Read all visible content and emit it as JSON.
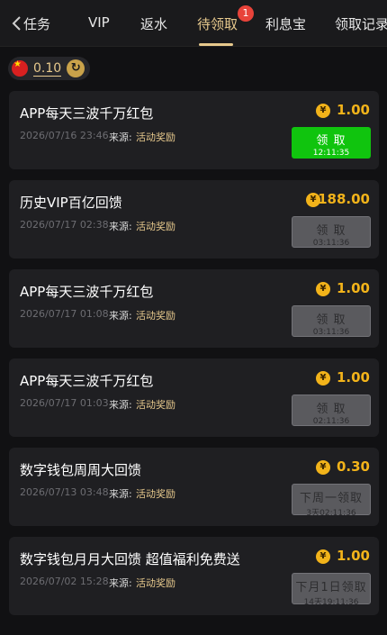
{
  "tabs": [
    {
      "label": "任务"
    },
    {
      "label": "VIP"
    },
    {
      "label": "返水"
    },
    {
      "label": "待领取",
      "badge": "1",
      "active": true
    },
    {
      "label": "利息宝"
    },
    {
      "label": "领取记录"
    }
  ],
  "balance": {
    "value": "0.10"
  },
  "source_label": "来源:",
  "cards": [
    {
      "title": "APP每天三波千万红包",
      "date": "2026/07/16 23:46",
      "source": "活动奖励",
      "amount": "1.00",
      "button": "领 取",
      "timer": "12:11:35",
      "state": "active"
    },
    {
      "title": "历史VIP百亿回馈",
      "date": "2026/07/17 02:38",
      "source": "活动奖励",
      "amount": "188.00",
      "button": "领 取",
      "timer": "03:11:36",
      "state": "disabled"
    },
    {
      "title": "APP每天三波千万红包",
      "date": "2026/07/17 01:08",
      "source": "活动奖励",
      "amount": "1.00",
      "button": "领 取",
      "timer": "03:11:36",
      "state": "disabled"
    },
    {
      "title": "APP每天三波千万红包",
      "date": "2026/07/17 01:03",
      "source": "活动奖励",
      "amount": "1.00",
      "button": "领 取",
      "timer": "02:11:36",
      "state": "disabled"
    },
    {
      "title": "数字钱包周周大回馈",
      "date": "2026/07/13 03:48",
      "source": "活动奖励",
      "amount": "0.30",
      "button": "下周一领取",
      "timer": "3天02:11:36",
      "state": "disabled"
    },
    {
      "title": "数字钱包月月大回馈 超值福利免费送",
      "date": "2026/07/02 15:28",
      "source": "活动奖励",
      "amount": "1.00",
      "button": "下月1日领取",
      "timer": "14天19:11:36",
      "state": "disabled"
    }
  ],
  "colors": {
    "accent_gold": "#e7c98d",
    "amount_gold": "#f2b31a",
    "claim_green": "#10c40e",
    "badge_red": "#e8433a"
  },
  "icons": {
    "back": "chevron-left-icon",
    "flag": "china-flag-icon",
    "refresh": "refresh-icon",
    "coin": "yuan-coin-icon"
  }
}
